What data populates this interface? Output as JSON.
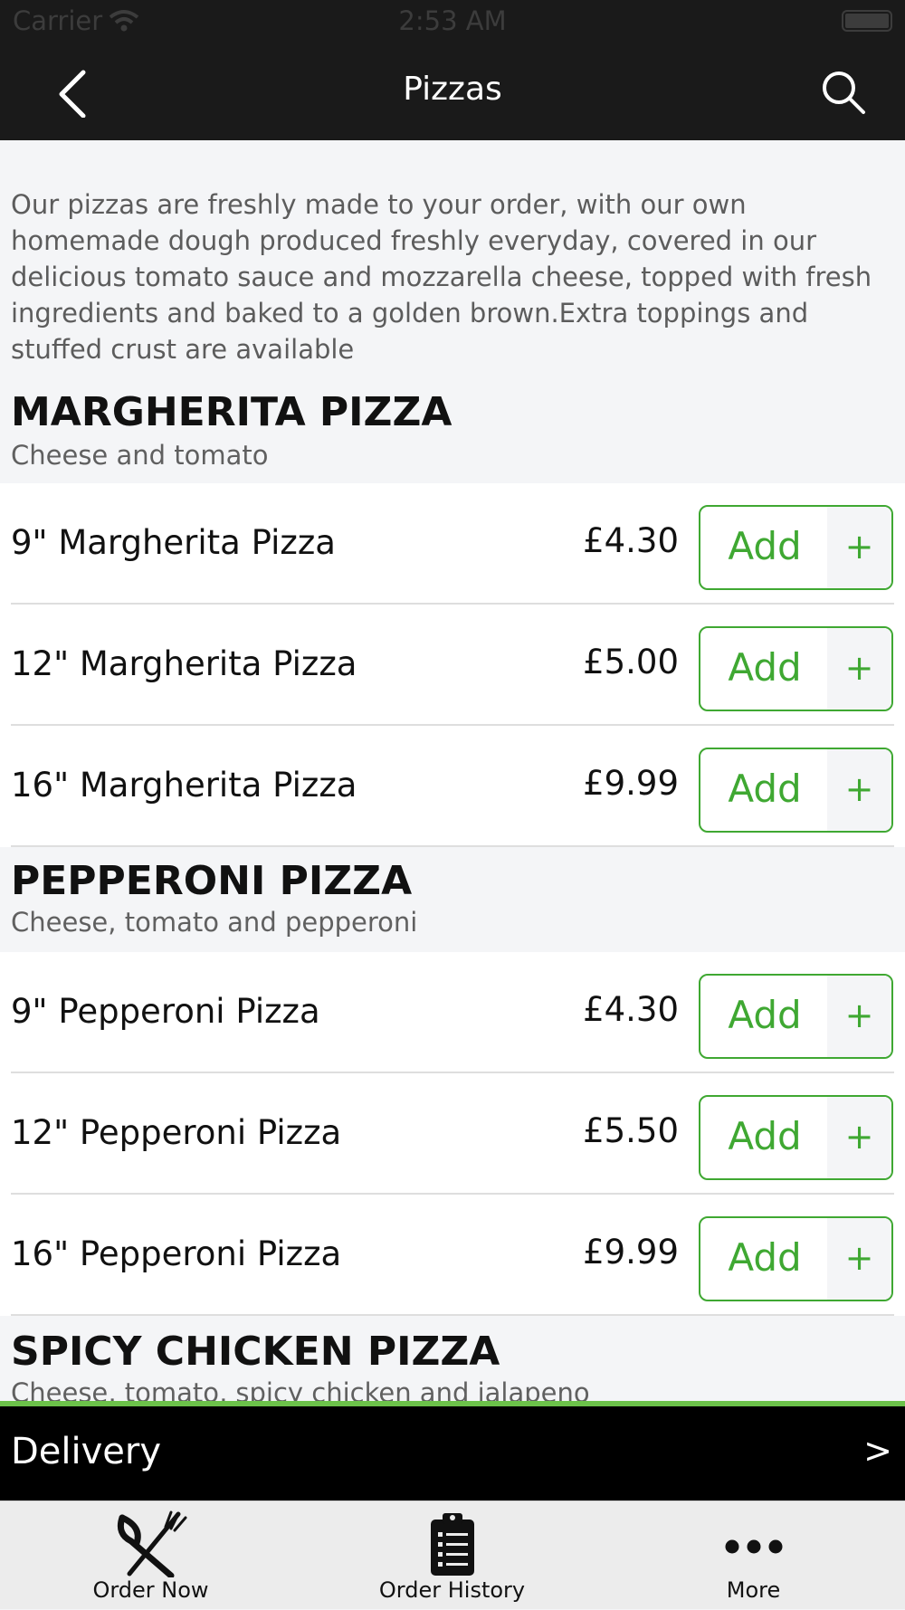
{
  "status": {
    "carrier": "Carrier",
    "time": "2:53 AM"
  },
  "nav": {
    "title": "Pizzas"
  },
  "intro": "Our pizzas are freshly made to your order, with our own homemade dough produced freshly everyday, covered in our delicious tomato sauce and mozzarella cheese, topped with fresh ingredients and baked to a golden brown.Extra toppings and stuffed crust are available",
  "sections": [
    {
      "title": "MARGHERITA PIZZA",
      "desc": "Cheese and tomato",
      "items": [
        {
          "name": "9\" Margherita Pizza",
          "price": "£4.30",
          "add": "Add",
          "plus": "+"
        },
        {
          "name": "12\" Margherita Pizza",
          "price": "£5.00",
          "add": "Add",
          "plus": "+"
        },
        {
          "name": "16\" Margherita Pizza",
          "price": "£9.99",
          "add": "Add",
          "plus": "+"
        }
      ]
    },
    {
      "title": "PEPPERONI PIZZA",
      "desc": "Cheese, tomato and pepperoni",
      "items": [
        {
          "name": "9\" Pepperoni Pizza",
          "price": "£4.30",
          "add": "Add",
          "plus": "+"
        },
        {
          "name": "12\" Pepperoni Pizza",
          "price": "£5.50",
          "add": "Add",
          "plus": "+"
        },
        {
          "name": "16\" Pepperoni Pizza",
          "price": "£9.99",
          "add": "Add",
          "plus": "+"
        }
      ]
    },
    {
      "title": "SPICY CHICKEN PIZZA",
      "desc": "Cheese, tomato, spicy chicken and jalapeno",
      "items": []
    }
  ],
  "delivery": {
    "label": "Delivery",
    "arrow": ">"
  },
  "tabs": [
    {
      "label": "Order Now",
      "icon": "fork-knife-icon"
    },
    {
      "label": "Order History",
      "icon": "clipboard-icon"
    },
    {
      "label": "More",
      "icon": "more-dots-icon"
    }
  ],
  "colors": {
    "accent": "#3fa832",
    "bar": "#1a1a1a",
    "divider_green": "#6cc24a"
  }
}
